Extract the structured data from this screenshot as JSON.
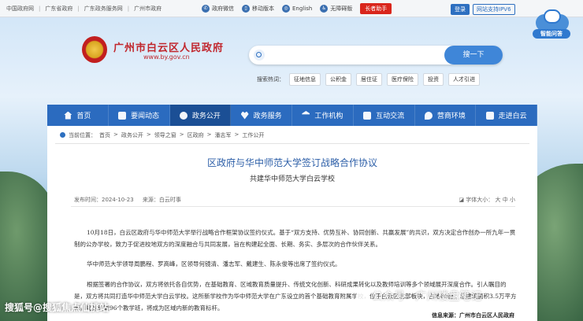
{
  "topbar": {
    "links": [
      "中国政府网",
      "广东省政府",
      "广东政务服务网",
      "广州市政府"
    ],
    "tools": {
      "wechat": "政府微信",
      "mobile": "移动版本",
      "english": "English",
      "accessible": "无障碍版",
      "elder": "长者助手"
    },
    "login": "登录",
    "ipv6": "网站支持IPV6"
  },
  "assistant": {
    "label": "智能问答"
  },
  "header": {
    "title": "广州市白云区人民政府",
    "url": "www.by.gov.cn"
  },
  "search": {
    "placeholder": "",
    "button": "搜一下",
    "hot_label": "搜索热词：",
    "hot_tags": [
      "征地信息",
      "公积金",
      "居住证",
      "医疗保险",
      "投资",
      "人才引进"
    ]
  },
  "nav": [
    {
      "label": "首页",
      "icon": "home-icon"
    },
    {
      "label": "要闻动态",
      "icon": "news-icon"
    },
    {
      "label": "政务公开",
      "icon": "disclosure-icon",
      "active": true
    },
    {
      "label": "政务服务",
      "icon": "heart-icon"
    },
    {
      "label": "工作机构",
      "icon": "building-icon"
    },
    {
      "label": "互动交流",
      "icon": "chat-icon"
    },
    {
      "label": "营商环境",
      "icon": "business-icon"
    },
    {
      "label": "走进白云",
      "icon": "grid-icon"
    }
  ],
  "breadcrumb": {
    "label": "当前位置：",
    "items": [
      "首页",
      "政务公开",
      "领导之窗",
      "区政府",
      "潘志军",
      "工作公开"
    ]
  },
  "article": {
    "title": "区政府与华中师范大学签订战略合作协议",
    "subtitle": "共建华中师范大学白云学校",
    "publish_label": "发布时间：",
    "publish_date": "2024-10-23",
    "source_label": "来源：",
    "source": "白云时事",
    "font_size_label": "字体大小：",
    "font_sizes": [
      "大",
      "中",
      "小"
    ],
    "paragraphs": [
      "10月18日，白云区政府与华中师范大学举行战略合作框架协议签约仪式。基于“双方支持、优势互补、协同创新、共赢发展”的共识，双方决定合作创办一所九年一贯制的公办学校，致力于促进校地双方的深度融合与共同发展，旨在构建起全面、长期、务实、多层次的合作伙伴关系。",
      "华中师范大学领导周鹏程、罗高峰，区领导何镜清、潘志军、戴建生、陈永俊等出席了签约仪式。",
      "根据签署的合作协议，双方将依托各自优势，在基础教育、区域教育质量提升、传统文化创新、科研成果转化以及教师培训等多个领域展开深度合作。引人瞩目的是，双方将共同打造华中师范大学白云学校。这所新学校作为华中师范大学在广东设立的首个基础教育附属学校，位于白云区北部板块，占地60亩，总建筑面积3.5万平方米，规划设置96个教学班，将成为区域内新的教育标杆。"
    ],
    "footer_source": "信息来源：广州市白云区人民政府"
  },
  "watermarks": {
    "left": "搜狐号@搜狐焦点仙桃站",
    "right": "公众号 · 广州楼盘笔记"
  }
}
